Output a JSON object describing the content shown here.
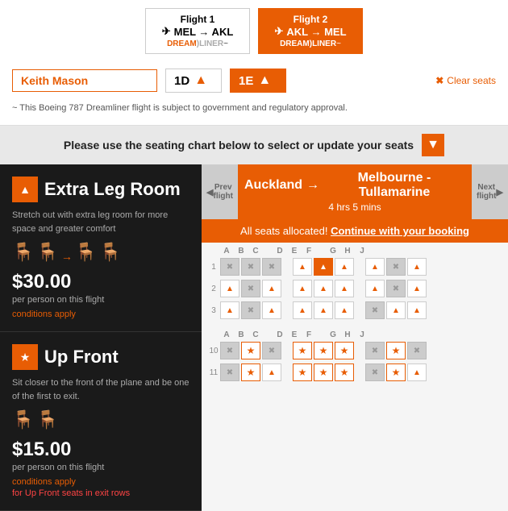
{
  "flights": [
    {
      "id": "flight1",
      "label": "Flight 1",
      "route": "MEL → AKL",
      "brand": "DREAM LINER~",
      "active": false
    },
    {
      "id": "flight2",
      "label": "Flight 2",
      "route": "AKL → MEL",
      "brand": "DREAM LINER~",
      "active": true
    }
  ],
  "passenger": {
    "name": "Keith Mason",
    "seat1": "1D",
    "seat2": "1E"
  },
  "clear_seats": "Clear seats",
  "disclaimer": "~ This Boeing 787 Dreamliner flight is subject to government and regulatory approval.",
  "instructions": "Please use the seating chart below to select or update your seats",
  "classes": [
    {
      "name": "Extra Leg Room",
      "desc": "Stretch out with extra leg room for more space and greater comfort",
      "price": "$30.00",
      "price_sub": "per person on this flight",
      "conditions": "conditions apply"
    },
    {
      "name": "Up Front",
      "desc": "Sit closer to the front of the plane and be one of the first to exit.",
      "price": "$15.00",
      "price_sub": "per person on this flight",
      "conditions": "conditions apply",
      "warning": "for Up Front seats in exit rows"
    }
  ],
  "flight_map": {
    "origin": "Auckland",
    "destination": "Melbourne - Tullamarine",
    "duration": "4 hrs 5 mins",
    "allocated_msg": "All seats allocated!",
    "continue_label": "Continue with your booking",
    "prev_label": "Prev flight",
    "next_label": "Next flight"
  },
  "col_labels_top": [
    "A",
    "B",
    "C",
    "",
    "D",
    "E",
    "F",
    "",
    "G",
    "H",
    "J"
  ],
  "seat_rows": [
    {
      "row_num": "1",
      "seats": [
        "taken",
        "taken",
        "taken",
        "gap",
        "taken",
        "selected",
        "taken",
        "gap",
        "available",
        "taken",
        "available"
      ]
    },
    {
      "row_num": "2",
      "seats": [
        "available",
        "taken",
        "available",
        "gap",
        "available",
        "available",
        "available",
        "gap",
        "available",
        "taken",
        "available"
      ]
    },
    {
      "row_num": "3",
      "seats": [
        "available",
        "taken",
        "available",
        "gap",
        "available",
        "available",
        "available",
        "gap",
        "taken",
        "available",
        "available"
      ]
    },
    {
      "row_num": "",
      "seats": [
        "",
        "",
        "",
        "",
        "",
        "",
        "",
        "",
        "",
        "",
        ""
      ]
    },
    {
      "row_num": "10",
      "seats": [
        "taken",
        "star",
        "taken",
        "gap",
        "star",
        "star",
        "star",
        "gap",
        "taken",
        "star",
        "taken"
      ]
    },
    {
      "row_num": "11",
      "seats": [
        "taken",
        "star",
        "available",
        "gap",
        "star",
        "star",
        "star",
        "gap",
        "taken",
        "star",
        "available"
      ]
    }
  ]
}
